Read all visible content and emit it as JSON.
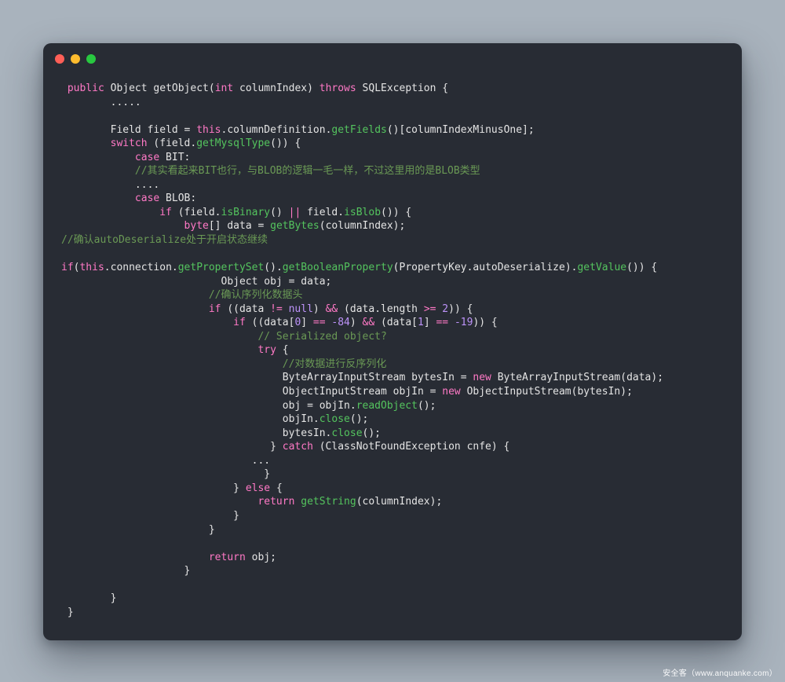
{
  "watermark": "安全客（www.anquanke.com）",
  "colors": {
    "page_bg": "#a9b3bd",
    "window_bg": "#282c34",
    "plain": "#e4e4e4",
    "keyword": "#ff79c6",
    "function": "#54c45e",
    "comment": "#6a9955",
    "number": "#bd93f9",
    "light_red": "#ff5f57",
    "light_yellow": "#febc2e",
    "light_green": "#28c840"
  },
  "window": {
    "controls": [
      "close",
      "minimize",
      "zoom"
    ]
  },
  "code": {
    "language": "java",
    "lines": [
      {
        "indent": 1,
        "tokens": [
          [
            "kw",
            "public"
          ],
          [
            "pl",
            " Object getObject("
          ],
          [
            "kw",
            "int"
          ],
          [
            "pl",
            " columnIndex) "
          ],
          [
            "kw",
            "throws"
          ],
          [
            "pl",
            " SQLException {"
          ]
        ]
      },
      {
        "indent": 8,
        "tokens": [
          [
            "pl",
            "....."
          ]
        ]
      },
      {
        "indent": 0,
        "tokens": []
      },
      {
        "indent": 8,
        "tokens": [
          [
            "pl",
            "Field field = "
          ],
          [
            "kw",
            "this"
          ],
          [
            "pl",
            ".columnDefinition."
          ],
          [
            "fn",
            "getFields"
          ],
          [
            "pl",
            "()[columnIndexMinusOne];"
          ]
        ]
      },
      {
        "indent": 8,
        "tokens": [
          [
            "kw",
            "switch"
          ],
          [
            "pl",
            " (field."
          ],
          [
            "fn",
            "getMysqlType"
          ],
          [
            "pl",
            "()) {"
          ]
        ]
      },
      {
        "indent": 12,
        "tokens": [
          [
            "kw",
            "case"
          ],
          [
            "pl",
            " BIT:"
          ]
        ]
      },
      {
        "indent": 12,
        "tokens": [
          [
            "cm",
            "//其实看起来BIT也行，与BLOB的逻辑一毛一样，不过这里用的是BLOB类型"
          ]
        ]
      },
      {
        "indent": 12,
        "tokens": [
          [
            "pl",
            "...."
          ]
        ]
      },
      {
        "indent": 12,
        "tokens": [
          [
            "kw",
            "case"
          ],
          [
            "pl",
            " BLOB:"
          ]
        ]
      },
      {
        "indent": 16,
        "tokens": [
          [
            "kw",
            "if"
          ],
          [
            "pl",
            " (field."
          ],
          [
            "fn",
            "isBinary"
          ],
          [
            "pl",
            "() "
          ],
          [
            "kw",
            "||"
          ],
          [
            "pl",
            " field."
          ],
          [
            "fn",
            "isBlob"
          ],
          [
            "pl",
            "()) {"
          ]
        ]
      },
      {
        "indent": 20,
        "tokens": [
          [
            "kw",
            "byte"
          ],
          [
            "pl",
            "[] data = "
          ],
          [
            "fn",
            "getBytes"
          ],
          [
            "pl",
            "(columnIndex);"
          ]
        ]
      },
      {
        "indent": 0,
        "tokens": [
          [
            "cm",
            "//确认autoDeserialize处于开启状态继续"
          ]
        ]
      },
      {
        "indent": 0,
        "tokens": []
      },
      {
        "indent": 0,
        "tokens": [
          [
            "kw",
            "if"
          ],
          [
            "pl",
            "("
          ],
          [
            "kw",
            "this"
          ],
          [
            "pl",
            ".connection."
          ],
          [
            "fn",
            "getPropertySet"
          ],
          [
            "pl",
            "()."
          ],
          [
            "fn",
            "getBooleanProperty"
          ],
          [
            "pl",
            "(PropertyKey.autoDeserialize)."
          ],
          [
            "fn",
            "getValue"
          ],
          [
            "pl",
            "()) {"
          ]
        ]
      },
      {
        "indent": 26,
        "tokens": [
          [
            "pl",
            "Object obj = data;"
          ]
        ]
      },
      {
        "indent": 24,
        "tokens": [
          [
            "cm",
            "//确认序列化数据头"
          ]
        ]
      },
      {
        "indent": 24,
        "tokens": [
          [
            "kw",
            "if"
          ],
          [
            "pl",
            " ((data "
          ],
          [
            "kw",
            "!="
          ],
          [
            "pl",
            " "
          ],
          [
            "num",
            "null"
          ],
          [
            "pl",
            ") "
          ],
          [
            "kw",
            "&&"
          ],
          [
            "pl",
            " (data.length "
          ],
          [
            "kw",
            ">="
          ],
          [
            "pl",
            " "
          ],
          [
            "num",
            "2"
          ],
          [
            "pl",
            ")) {"
          ]
        ]
      },
      {
        "indent": 28,
        "tokens": [
          [
            "kw",
            "if"
          ],
          [
            "pl",
            " ((data["
          ],
          [
            "num",
            "0"
          ],
          [
            "pl",
            "] "
          ],
          [
            "kw",
            "=="
          ],
          [
            "pl",
            " "
          ],
          [
            "num",
            "-84"
          ],
          [
            "pl",
            ") "
          ],
          [
            "kw",
            "&&"
          ],
          [
            "pl",
            " (data["
          ],
          [
            "num",
            "1"
          ],
          [
            "pl",
            "] "
          ],
          [
            "kw",
            "=="
          ],
          [
            "pl",
            " "
          ],
          [
            "num",
            "-19"
          ],
          [
            "pl",
            ")) {"
          ]
        ]
      },
      {
        "indent": 32,
        "tokens": [
          [
            "cm",
            "// Serialized object?"
          ]
        ]
      },
      {
        "indent": 32,
        "tokens": [
          [
            "kw",
            "try"
          ],
          [
            "pl",
            " {"
          ]
        ]
      },
      {
        "indent": 36,
        "tokens": [
          [
            "cm",
            "//对数据进行反序列化"
          ]
        ]
      },
      {
        "indent": 36,
        "tokens": [
          [
            "pl",
            "ByteArrayInputStream bytesIn = "
          ],
          [
            "kw",
            "new"
          ],
          [
            "pl",
            " ByteArrayInputStream(data);"
          ]
        ]
      },
      {
        "indent": 36,
        "tokens": [
          [
            "pl",
            "ObjectInputStream objIn = "
          ],
          [
            "kw",
            "new"
          ],
          [
            "pl",
            " ObjectInputStream(bytesIn);"
          ]
        ]
      },
      {
        "indent": 36,
        "tokens": [
          [
            "pl",
            "obj = objIn."
          ],
          [
            "fn",
            "readObject"
          ],
          [
            "pl",
            "();"
          ]
        ]
      },
      {
        "indent": 36,
        "tokens": [
          [
            "pl",
            "objIn."
          ],
          [
            "fn",
            "close"
          ],
          [
            "pl",
            "();"
          ]
        ]
      },
      {
        "indent": 36,
        "tokens": [
          [
            "pl",
            "bytesIn."
          ],
          [
            "fn",
            "close"
          ],
          [
            "pl",
            "();"
          ]
        ]
      },
      {
        "indent": 34,
        "tokens": [
          [
            "pl",
            "} "
          ],
          [
            "kw",
            "catch"
          ],
          [
            "pl",
            " (ClassNotFoundException cnfe) {"
          ]
        ]
      },
      {
        "indent": 31,
        "tokens": [
          [
            "pl",
            "..."
          ]
        ]
      },
      {
        "indent": 33,
        "tokens": [
          [
            "pl",
            "}"
          ]
        ]
      },
      {
        "indent": 28,
        "tokens": [
          [
            "pl",
            "} "
          ],
          [
            "kw",
            "else"
          ],
          [
            "pl",
            " {"
          ]
        ]
      },
      {
        "indent": 32,
        "tokens": [
          [
            "kw",
            "return"
          ],
          [
            "pl",
            " "
          ],
          [
            "fn",
            "getString"
          ],
          [
            "pl",
            "(columnIndex);"
          ]
        ]
      },
      {
        "indent": 28,
        "tokens": [
          [
            "pl",
            "}"
          ]
        ]
      },
      {
        "indent": 24,
        "tokens": [
          [
            "pl",
            "}"
          ]
        ]
      },
      {
        "indent": 0,
        "tokens": []
      },
      {
        "indent": 24,
        "tokens": [
          [
            "kw",
            "return"
          ],
          [
            "pl",
            " obj;"
          ]
        ]
      },
      {
        "indent": 20,
        "tokens": [
          [
            "pl",
            "}"
          ]
        ]
      },
      {
        "indent": 0,
        "tokens": []
      },
      {
        "indent": 8,
        "tokens": [
          [
            "pl",
            "}"
          ]
        ]
      },
      {
        "indent": 1,
        "tokens": [
          [
            "pl",
            "}"
          ]
        ]
      }
    ]
  }
}
